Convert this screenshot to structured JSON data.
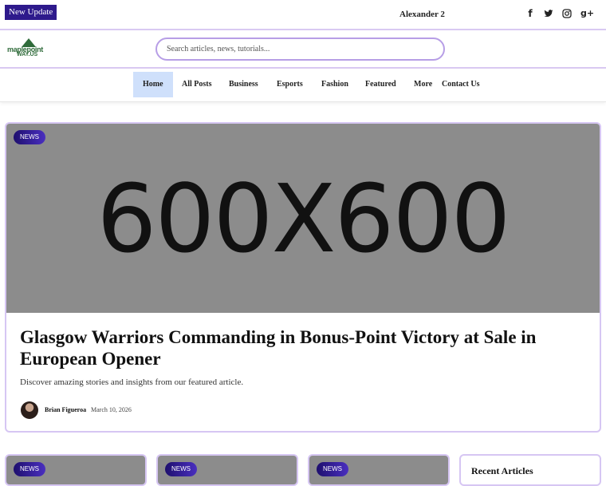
{
  "topbar": {
    "new_update_label": "New Update",
    "user_name": "Alexander 2",
    "socials": [
      {
        "icon": "facebook-icon",
        "glyph": "f"
      },
      {
        "icon": "twitter-icon",
        "glyph": "🐦"
      },
      {
        "icon": "instagram-icon",
        "glyph": "◎"
      },
      {
        "icon": "google-plus-icon",
        "glyph": "g+"
      }
    ]
  },
  "header": {
    "logo_line1": "maplepoint",
    "logo_line2": "WAY.US",
    "search_placeholder": "Search articles, news, tutorials..."
  },
  "nav": {
    "items": [
      {
        "label": "Home",
        "active": true
      },
      {
        "label": "All Posts"
      },
      {
        "label": "Business"
      },
      {
        "label": "Esports"
      },
      {
        "label": "Fashion"
      },
      {
        "label": "Featured"
      },
      {
        "label": "More"
      },
      {
        "label": "Contact Us"
      }
    ]
  },
  "featured": {
    "badge": "NEWS",
    "thumb_text": "600X600",
    "title": "Glasgow Warriors Commanding in Bonus-Point Victory at Sale in European Opener",
    "description": "Discover amazing stories and insights from our featured article.",
    "author": "Brian Figueroa",
    "date": "March 10, 2026"
  },
  "small_cards": [
    {
      "badge": "NEWS"
    },
    {
      "badge": "NEWS"
    },
    {
      "badge": "NEWS"
    }
  ],
  "sidebar": {
    "recent_title": "Recent Articles"
  },
  "colors": {
    "accent": "#2e1a8c",
    "border": "#d6c6f3",
    "nav_active": "#cfe0fb"
  }
}
